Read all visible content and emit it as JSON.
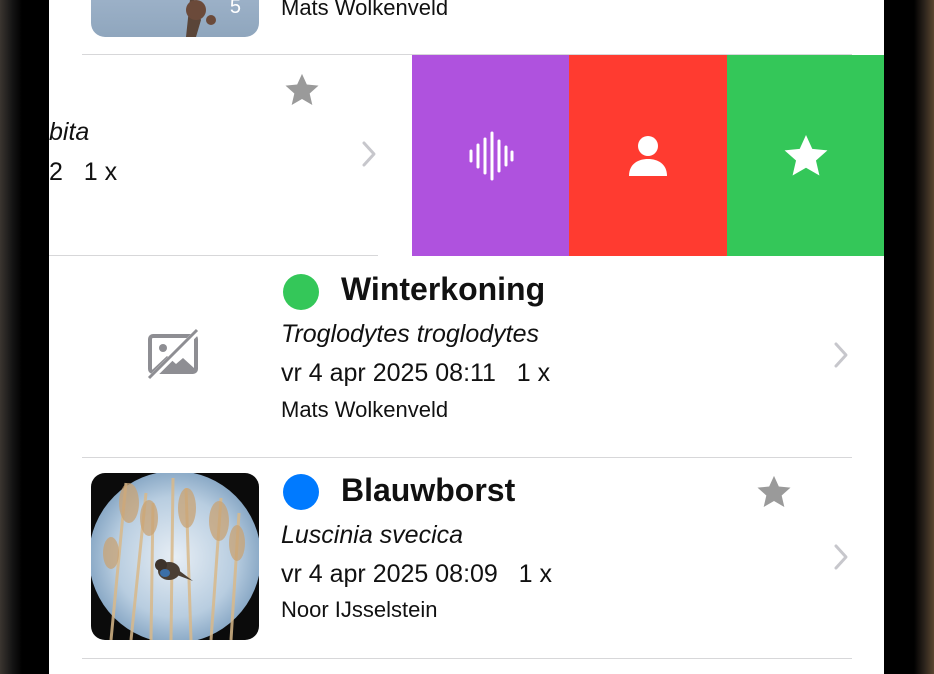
{
  "colors": {
    "green_dot": "#34C759",
    "blue_dot": "#007AFF",
    "action_sound": "#AF52DE",
    "action_person": "#FF3B30",
    "action_favorite": "#34C759",
    "chevron": "#C7C7CC",
    "star_inactive": "#9A9A9A"
  },
  "rows": {
    "top": {
      "photo_count": "5",
      "observer": "Mats Wolkenveld"
    },
    "swiped": {
      "latin_fragment": "bita",
      "meta_fragment": "2   1 x",
      "icon": "star-icon"
    },
    "winterkoning": {
      "name": "Winterkoning",
      "latin": "Troglodytes troglodytes",
      "meta": "vr 4 apr 2025 08:11   1 x",
      "observer": "Mats Wolkenveld",
      "dot_color": "green",
      "thumb_icon": "no-image-icon"
    },
    "blauwborst": {
      "name": "Blauwborst",
      "latin": "Luscinia svecica",
      "meta": "vr 4 apr 2025 08:09   1 x",
      "observer": "Noor IJsselstein",
      "dot_color": "blue",
      "icon": "star-icon"
    }
  },
  "swipe_actions": [
    {
      "icon": "waveform-icon",
      "color": "#AF52DE"
    },
    {
      "icon": "person-icon",
      "color": "#FF3B30"
    },
    {
      "icon": "star-icon",
      "color": "#34C759"
    }
  ]
}
